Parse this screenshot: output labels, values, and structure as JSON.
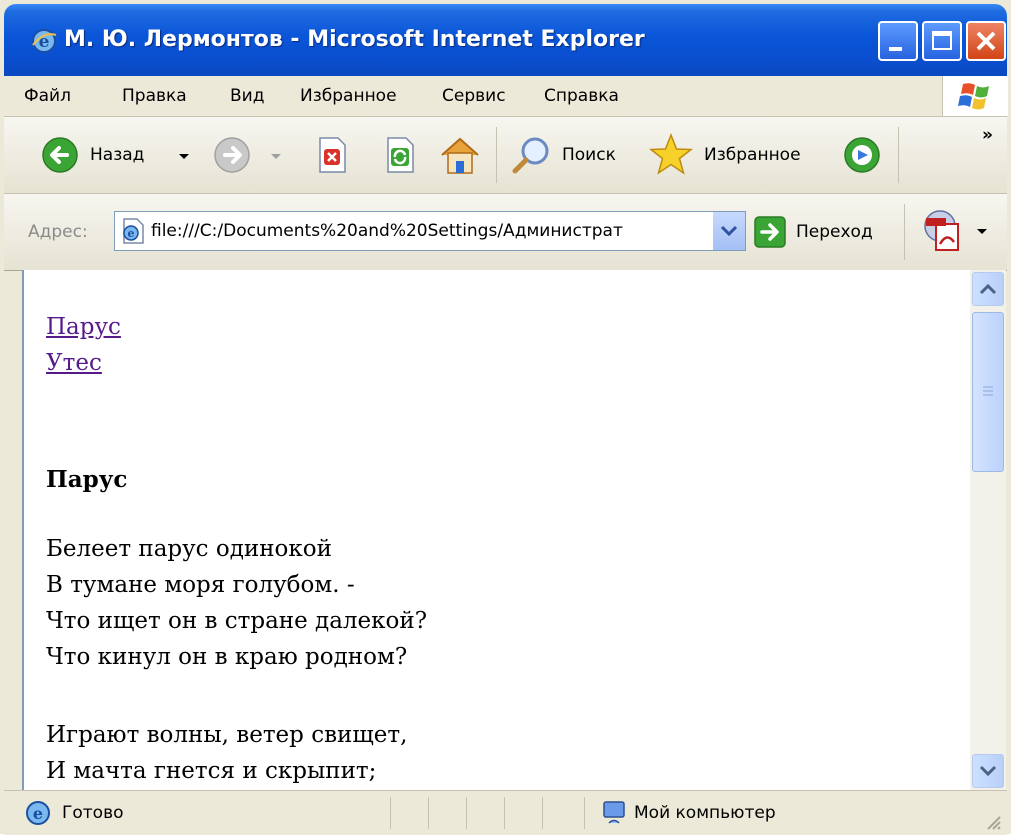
{
  "window": {
    "title": "М. Ю. Лермонтов - Microsoft Internet Explorer"
  },
  "menu": [
    "Файл",
    "Правка",
    "Вид",
    "Избранное",
    "Сервис",
    "Справка"
  ],
  "toolbar": {
    "back_label": "Назад",
    "search_label": "Поиск",
    "favorites_label": "Избранное",
    "overflow": "»"
  },
  "address": {
    "label": "Адрес:",
    "url": "file:///C:/Documents%20and%20Settings/Администрат",
    "go_label": "Переход"
  },
  "content": {
    "links": [
      "Парус",
      "Утес"
    ],
    "poem_title": "Парус",
    "stanza1": [
      "Белеет парус одинокой",
      "В тумане моря голубом. -",
      "Что ищет он в стране далекой?",
      "Что кинул он в краю родном?"
    ],
    "stanza2": [
      "Играют волны, ветер свищет,",
      "И мачта гнется и скрыпит;"
    ]
  },
  "status": {
    "text": "Готово",
    "zone": "Мой компьютер"
  },
  "colors": {
    "title_bar": "#0a55d8",
    "link_visited": "#551a8b",
    "chrome": "#ece9d8"
  }
}
